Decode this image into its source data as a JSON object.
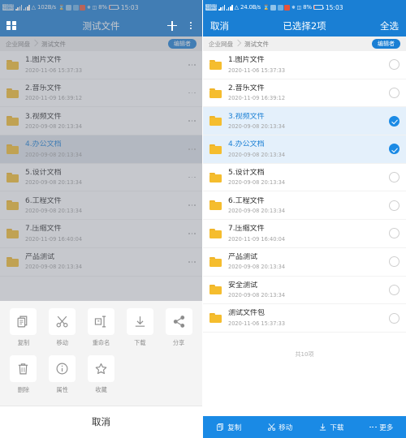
{
  "status_bar": {
    "carrier_1": "中国联通",
    "carrier_2": "中国移动",
    "network_speed_left": "102B/s",
    "network_speed_right": "24.0B/s",
    "battery": "8%",
    "time": "15:03"
  },
  "left": {
    "appbar": {
      "title": "测试文件",
      "grid_icon": "grid-icon",
      "add_icon": "plus-icon",
      "menu_icon": "kebab-menu-icon"
    },
    "breadcrumb": {
      "root": "企业网盘",
      "current": "测试文件",
      "badge": "编辑者"
    },
    "files": [
      {
        "name": "1.图片文件",
        "date": "2020-11-06 15:37:33",
        "selected": false
      },
      {
        "name": "2.音乐文件",
        "date": "2020-11-09 16:39:12",
        "selected": false
      },
      {
        "name": "3.视频文件",
        "date": "2020-09-08 20:13:34",
        "selected": false
      },
      {
        "name": "4.办公文档",
        "date": "2020-09-08 20:13:34",
        "selected": true
      },
      {
        "name": "5.设计文档",
        "date": "2020-09-08 20:13:34",
        "selected": false
      },
      {
        "name": "6.工程文件",
        "date": "2020-09-08 20:13:34",
        "selected": false
      },
      {
        "name": "7.压缩文件",
        "date": "2020-11-09 16:40:04",
        "selected": false
      },
      {
        "name": "产品测试",
        "date": "2020-09-08 20:13:34",
        "selected": false
      }
    ],
    "action_sheet": {
      "actions": [
        {
          "label": "复制",
          "icon": "copy-icon"
        },
        {
          "label": "移动",
          "icon": "scissors-icon"
        },
        {
          "label": "重命名",
          "icon": "rename-icon"
        },
        {
          "label": "下载",
          "icon": "download-icon"
        },
        {
          "label": "分享",
          "icon": "share-icon"
        },
        {
          "label": "删除",
          "icon": "trash-icon"
        },
        {
          "label": "属性",
          "icon": "info-icon"
        },
        {
          "label": "收藏",
          "icon": "star-icon"
        }
      ],
      "cancel": "取消"
    }
  },
  "right": {
    "selbar": {
      "cancel": "取消",
      "title": "已选择2项",
      "select_all": "全选"
    },
    "breadcrumb": {
      "root": "企业网盘",
      "current": "测试文件",
      "badge": "编辑者"
    },
    "files": [
      {
        "name": "1.图片文件",
        "date": "2020-11-06 15:37:33",
        "checked": false
      },
      {
        "name": "2.音乐文件",
        "date": "2020-11-09 16:39:12",
        "checked": false
      },
      {
        "name": "3.视频文件",
        "date": "2020-09-08 20:13:34",
        "checked": true
      },
      {
        "name": "4.办公文档",
        "date": "2020-09-08 20:13:34",
        "checked": true
      },
      {
        "name": "5.设计文档",
        "date": "2020-09-08 20:13:34",
        "checked": false
      },
      {
        "name": "6.工程文件",
        "date": "2020-09-08 20:13:34",
        "checked": false
      },
      {
        "name": "7.压缩文件",
        "date": "2020-11-09 16:40:04",
        "checked": false
      },
      {
        "name": "产品测试",
        "date": "2020-09-08 20:13:34",
        "checked": false
      },
      {
        "name": "安全测试",
        "date": "2020-09-08 20:13:34",
        "checked": false
      },
      {
        "name": "测试文件包",
        "date": "2020-11-06 15:37:33",
        "checked": false
      }
    ],
    "total_text": "共10项",
    "toolbar": [
      {
        "label": "复制",
        "icon": "copy-icon"
      },
      {
        "label": "移动",
        "icon": "scissors-icon"
      },
      {
        "label": "下载",
        "icon": "download-icon"
      },
      {
        "label": "更多",
        "icon": "more-dots-icon"
      }
    ]
  },
  "colors": {
    "brand_blue": "#1a7fd4",
    "accent_blue": "#1a8ae5",
    "folder_yellow": "#f5bd2e",
    "selected_row": "#e4f0fb"
  }
}
